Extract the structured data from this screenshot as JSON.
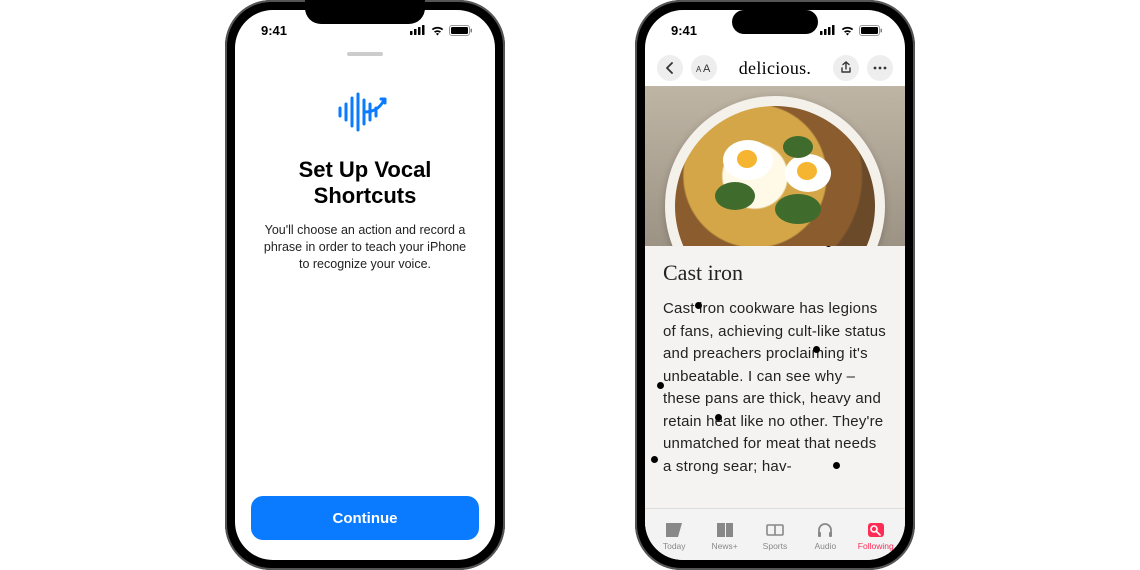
{
  "status": {
    "time": "9:41"
  },
  "phone_left": {
    "title": "Set Up Vocal Shortcuts",
    "description": "You'll choose an action and record a phrase in order to teach your iPhone to recognize your voice.",
    "continue_label": "Continue"
  },
  "phone_right": {
    "brand": "delicious.",
    "article_title": "Cast iron",
    "article_body": "Cast iron cookware has legions of fans, achieving cult-like status and preachers proclaiming it's unbeatable. I can see why – these pans are thick, heavy and retain heat like no other. They're unmatched for meat that needs a strong sear; hav-",
    "tabs": {
      "today": "Today",
      "newsplus": "News+",
      "sports": "Sports",
      "audio": "Audio",
      "following": "Following"
    }
  }
}
